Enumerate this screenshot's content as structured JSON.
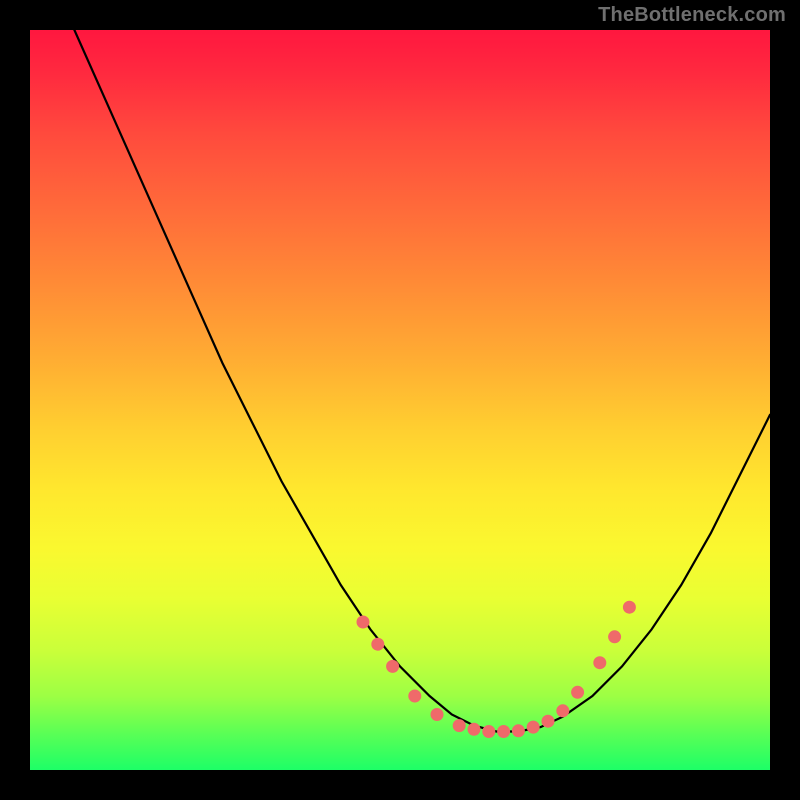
{
  "watermark": "TheBottleneck.com",
  "chart_data": {
    "type": "line",
    "title": "",
    "xlabel": "",
    "ylabel": "",
    "xlim": [
      0,
      100
    ],
    "ylim": [
      0,
      100
    ],
    "grid": false,
    "series": [
      {
        "name": "curve",
        "x": [
          6,
          10,
          14,
          18,
          22,
          26,
          30,
          34,
          38,
          42,
          46,
          50,
          54,
          57,
          60,
          63,
          66,
          69,
          72,
          76,
          80,
          84,
          88,
          92,
          96,
          100
        ],
        "y": [
          100,
          91,
          82,
          73,
          64,
          55,
          47,
          39,
          32,
          25,
          19,
          14,
          10,
          7.5,
          6,
          5.2,
          5.2,
          5.8,
          7.2,
          10,
          14,
          19,
          25,
          32,
          40,
          48
        ]
      }
    ],
    "points": {
      "name": "markers",
      "x": [
        45,
        47,
        49,
        52,
        55,
        58,
        60,
        62,
        64,
        66,
        68,
        70,
        72,
        74,
        77,
        79,
        81
      ],
      "y": [
        20,
        17,
        14,
        10,
        7.5,
        6,
        5.5,
        5.2,
        5.2,
        5.3,
        5.8,
        6.6,
        8,
        10.5,
        14.5,
        18,
        22
      ]
    },
    "gradient_stops": [
      {
        "pos": 0,
        "color": "#ff173f"
      },
      {
        "pos": 50,
        "color": "#ffcf30"
      },
      {
        "pos": 75,
        "color": "#e8ff33"
      },
      {
        "pos": 100,
        "color": "#1dff67"
      }
    ]
  }
}
